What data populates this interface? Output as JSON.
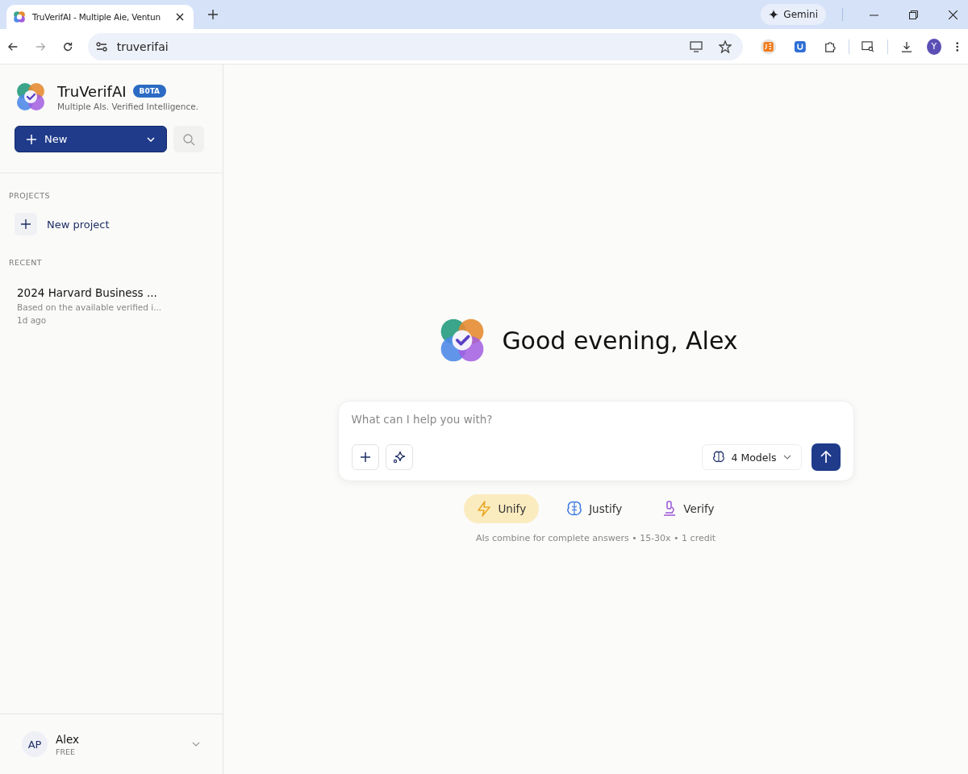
{
  "browser": {
    "tab": {
      "title": "TruVerifAI - Multiple Aie, Ventun",
      "selected": true
    },
    "gemini": "Gemini",
    "url": "truverifai",
    "profile": "Y"
  },
  "sidebar": {
    "brand": "TruVerifAI",
    "badge": "B0TA",
    "tagline": "Multiple AIs. Verified Intelligence.",
    "new_button": "New",
    "projects_heading": "PROJECTS",
    "new_project": "New project",
    "recent_heading": "RECENT",
    "recent": [
      {
        "title": "2024 Harvard Business ...",
        "preview": "Based on the available verified i...",
        "time": "1d ago"
      }
    ],
    "user": {
      "initials": "AP",
      "name": "Alex",
      "plan": "FREE"
    }
  },
  "main": {
    "greeting": "Good evening, Alex",
    "placeholder": "What can I help you with?",
    "models": "4 Models",
    "modes": [
      {
        "kind": "unify",
        "label": "Unify",
        "selected": true
      },
      {
        "kind": "justify",
        "label": "Justify",
        "selected": false
      },
      {
        "kind": "verify",
        "label": "Verify",
        "selected": false
      }
    ],
    "hint": "AIs combine for complete answers • 15-30x • 1 credit"
  }
}
